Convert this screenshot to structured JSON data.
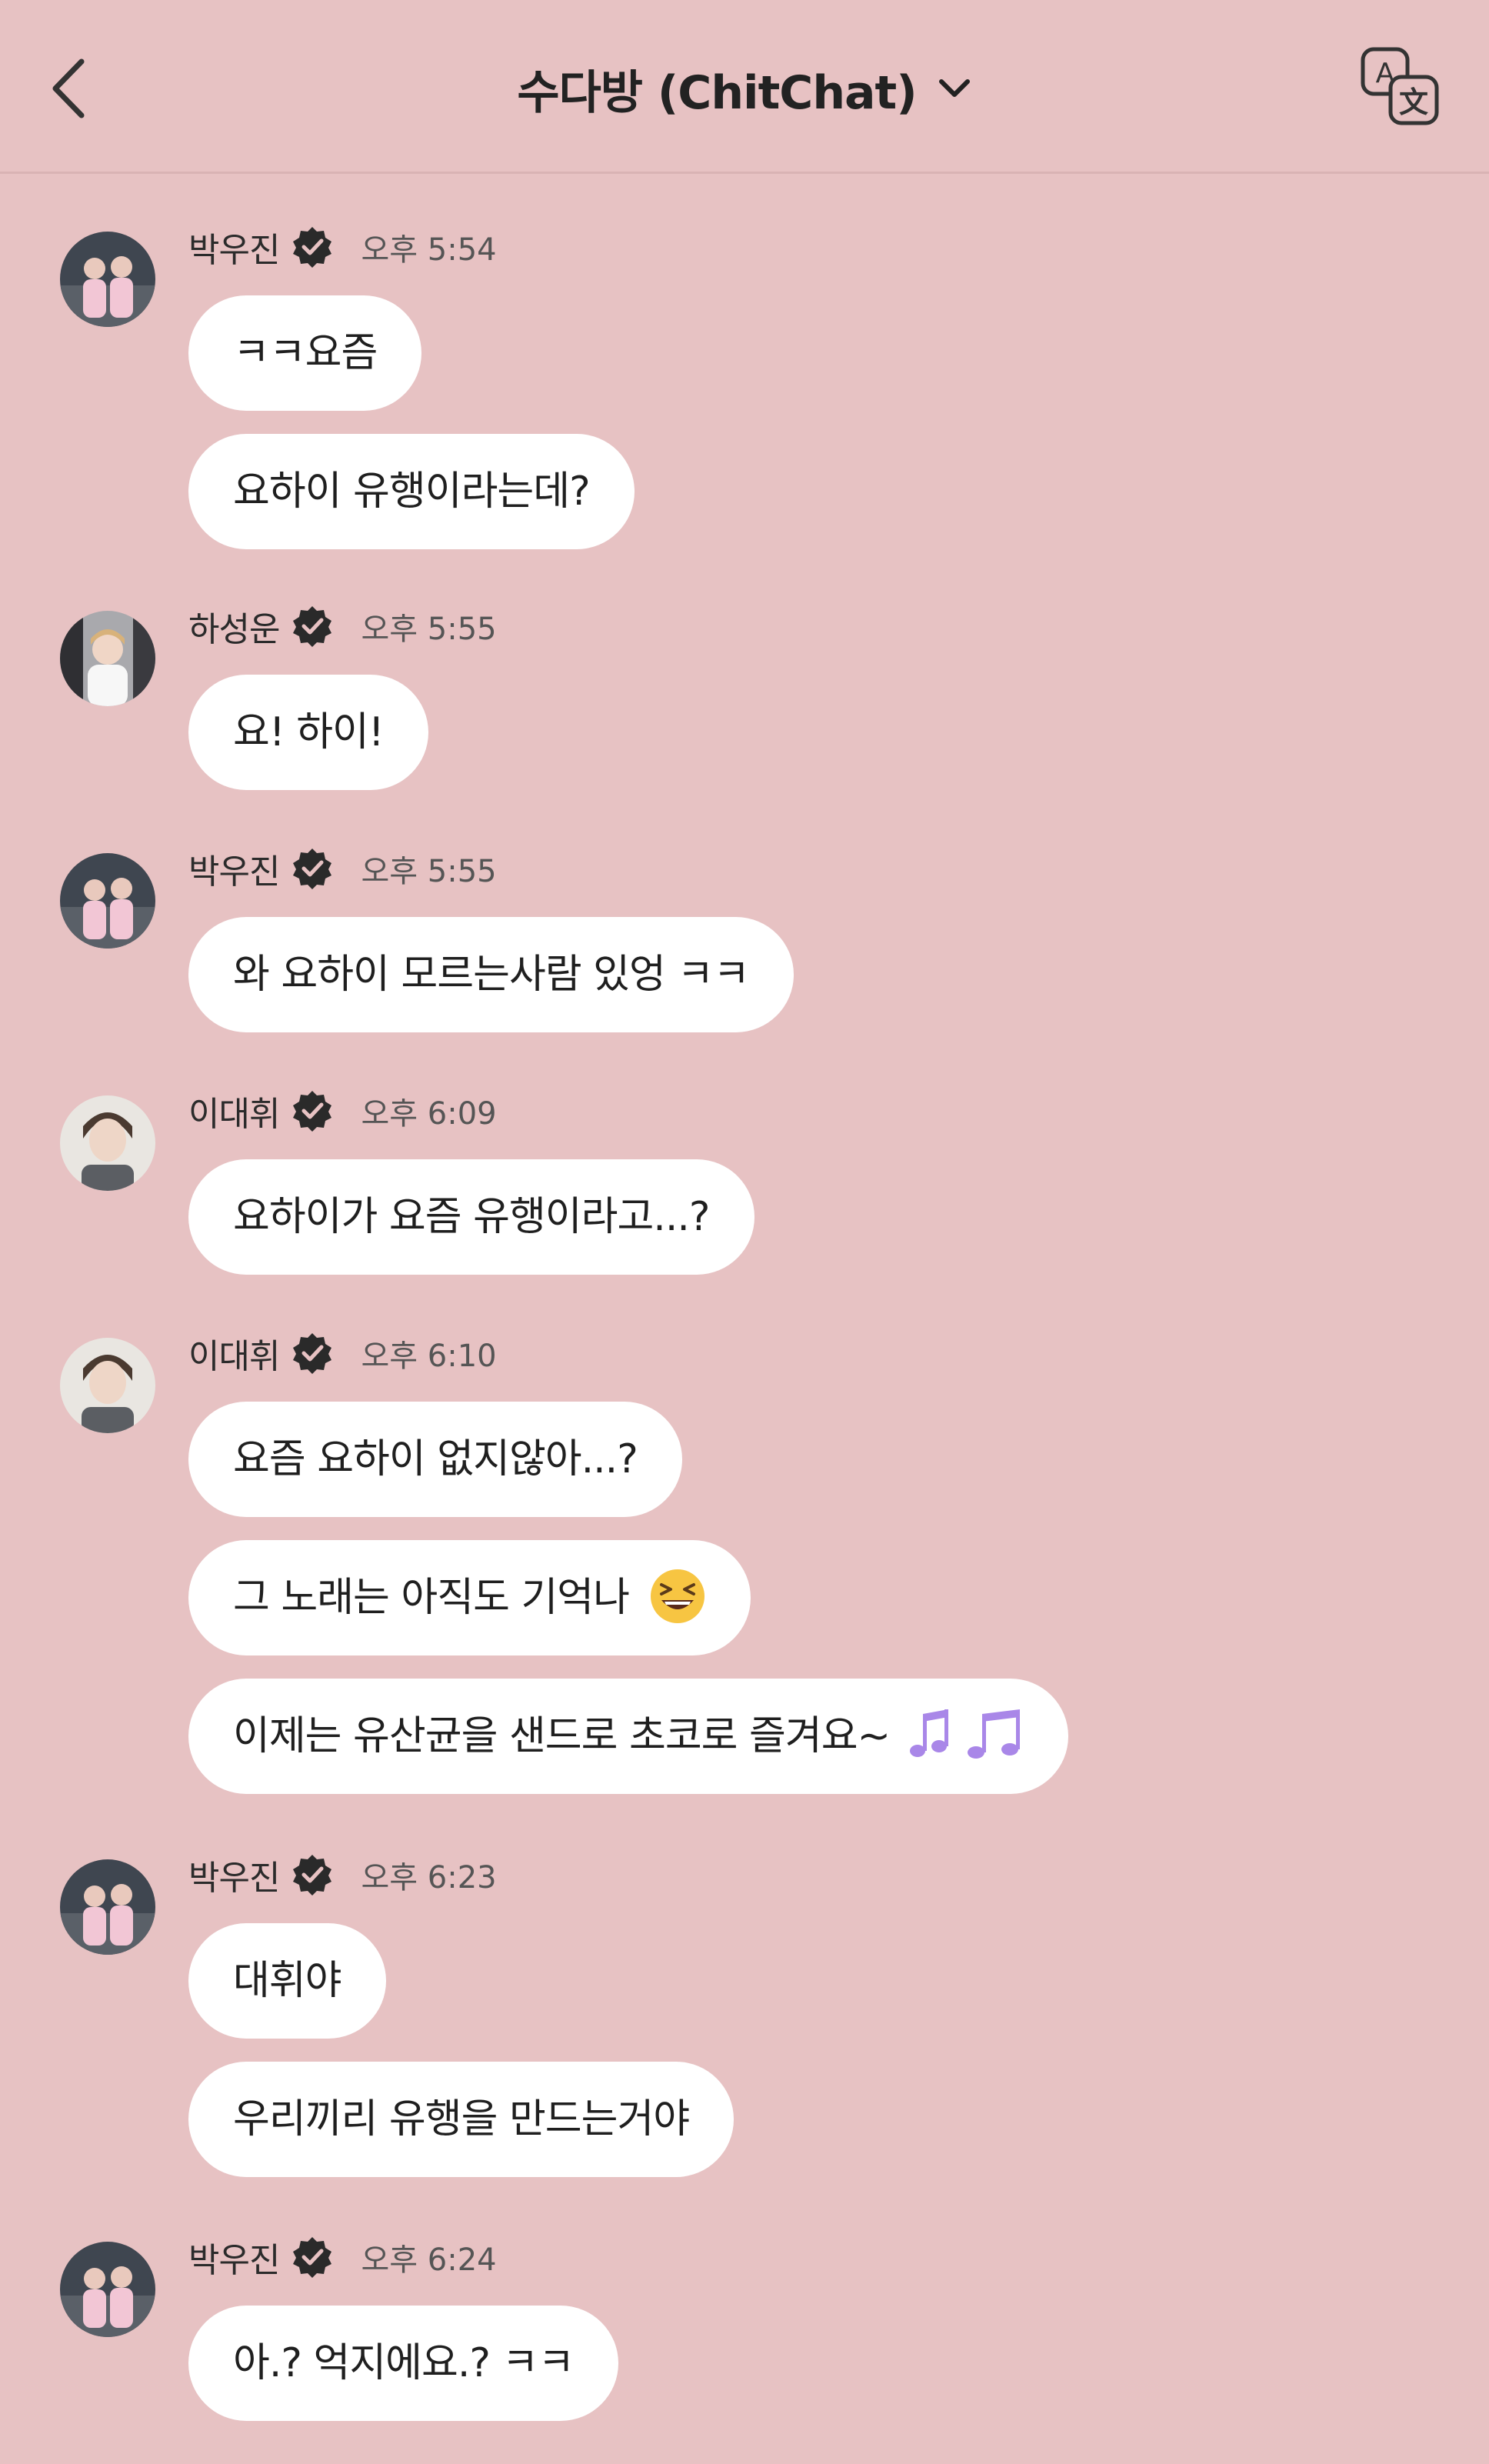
{
  "header": {
    "title": "수다방 (ChitChat)",
    "icons": {
      "back": "back-chevron-icon",
      "dropdown": "chevron-down-icon",
      "translate": "translate-icon"
    }
  },
  "messages": [
    {
      "sender": "박우진",
      "time": "오후 5:54",
      "avatar": "woojin",
      "bubbles": [
        "ㅋㅋ요즘",
        "요하이 유행이라는데?"
      ]
    },
    {
      "sender": "하성운",
      "time": "오후 5:55",
      "avatar": "sungwoon",
      "bubbles": [
        "요! 하이!"
      ]
    },
    {
      "sender": "박우진",
      "time": "오후 5:55",
      "avatar": "woojin",
      "bubbles": [
        "와 요하이 모르는사람 있엉 ㅋㅋ"
      ]
    },
    {
      "sender": "이대휘",
      "time": "오후 6:09",
      "avatar": "daehwi",
      "bubbles": [
        "요하이가 요즘 유행이라고...?"
      ]
    },
    {
      "sender": "이대휘",
      "time": "오후 6:10",
      "avatar": "daehwi",
      "bubbles": [
        "요즘 요하이 없지않아...?",
        "그 노래는 아직도 기억나",
        "이제는 유산균을 샌드로 초코로 즐겨요~"
      ]
    },
    {
      "sender": "박우진",
      "time": "오후 6:23",
      "avatar": "woojin",
      "bubbles": [
        "대휘야",
        "우리끼리 유행을 만드는거야"
      ]
    },
    {
      "sender": "박우진",
      "time": "오후 6:24",
      "avatar": "woojin",
      "bubbles": [
        "아.? 억지에요.? ㅋㅋ"
      ]
    }
  ],
  "colors": {
    "background": "#e7c2c3",
    "bubble": "#ffffff",
    "verified": "#2a2a2a",
    "notes": "#a987e8"
  }
}
